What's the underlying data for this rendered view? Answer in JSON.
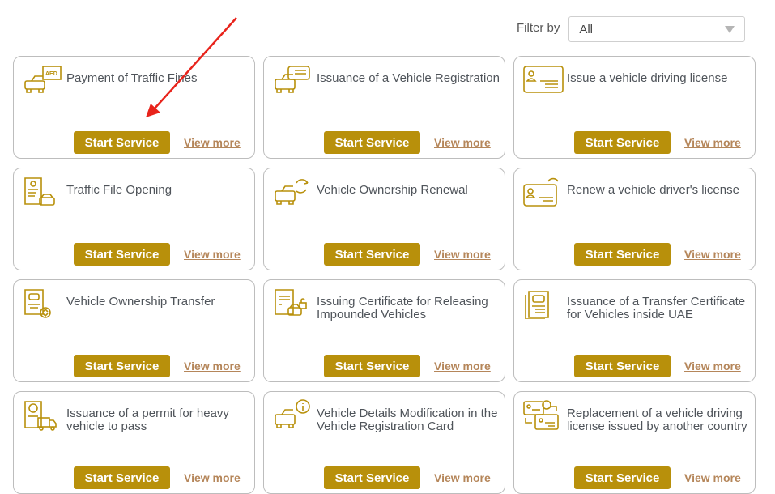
{
  "filter": {
    "label": "Filter by",
    "selected": "All"
  },
  "colors": {
    "accent": "#b8900b",
    "link": "#b5865a",
    "annotation_arrow": "#e8231b"
  },
  "cards": [
    {
      "title": "Payment of Traffic Fines",
      "icon": "car-fine-aed-icon",
      "button": "Start Service",
      "link": "View more"
    },
    {
      "title": "Issuance of a Vehicle Registration",
      "icon": "car-card-icon",
      "button": "Start Service",
      "link": "View more"
    },
    {
      "title": "Issue a vehicle driving license",
      "icon": "license-card-icon",
      "button": "Start Service",
      "link": "View more"
    },
    {
      "title": "Traffic File Opening",
      "icon": "document-car-icon",
      "button": "Start Service",
      "link": "View more"
    },
    {
      "title": "Vehicle Ownership Renewal",
      "icon": "car-renew-icon",
      "button": "Start Service",
      "link": "View more"
    },
    {
      "title": "Renew a vehicle driver's license",
      "icon": "license-renew-icon",
      "button": "Start Service",
      "link": "View more"
    },
    {
      "title": "Vehicle Ownership Transfer",
      "icon": "document-transfer-icon",
      "button": "Start Service",
      "link": "View more"
    },
    {
      "title": "Issuing Certificate for Releasing Impounded Vehicles",
      "icon": "certificate-car-lock-icon",
      "button": "Start Service",
      "link": "View more"
    },
    {
      "title": "Issuance of a Transfer Certificate for Vehicles inside UAE",
      "icon": "certificate-car-icon",
      "button": "Start Service",
      "link": "View more"
    },
    {
      "title": "Issuance of a permit for heavy vehicle to pass",
      "icon": "permit-truck-icon",
      "button": "Start Service",
      "link": "View more"
    },
    {
      "title": "Vehicle Details Modification in the Vehicle Registration Card",
      "icon": "car-info-icon",
      "button": "Start Service",
      "link": "View more"
    },
    {
      "title": "Replacement of a vehicle driving license issued by another country",
      "icon": "license-exchange-icon",
      "button": "Start Service",
      "link": "View more"
    }
  ]
}
